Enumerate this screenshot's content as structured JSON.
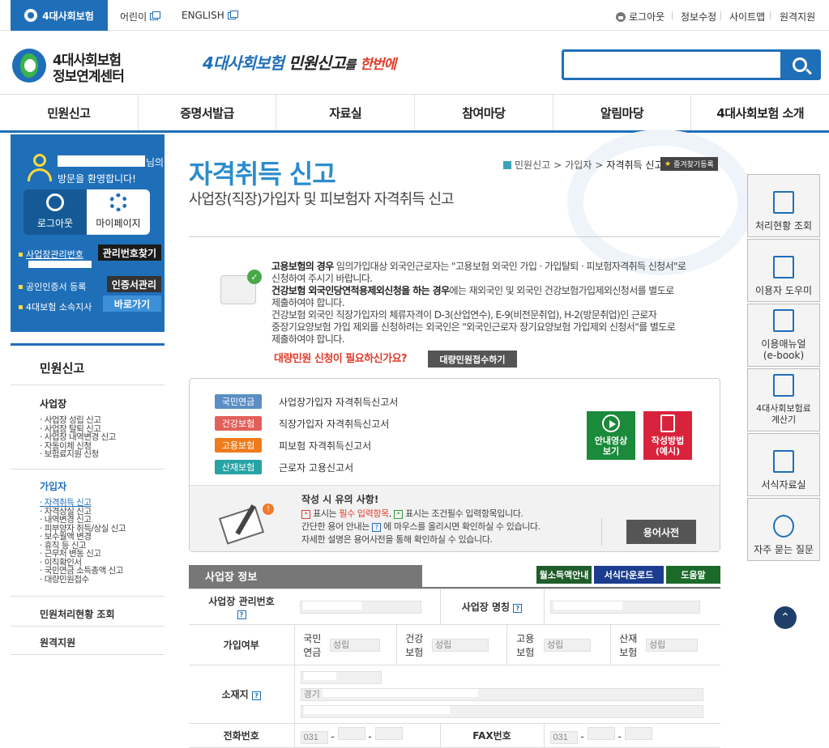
{
  "topbar": {
    "home": "4대사회보험",
    "links": [
      "어린이",
      "ENGLISH"
    ],
    "right": [
      "로그아웃",
      "정보수정",
      "사이트맵",
      "원격지원"
    ]
  },
  "header": {
    "logo_line1": "4대사회보험",
    "logo_line2": "정보연계센터",
    "slogan_blue": "4대사회보험",
    "slogan_black": "민원신고",
    "slogan_mid": "를",
    "slogan_red": "한번에",
    "search_placeholder": ""
  },
  "gnb": [
    "민원신고",
    "증명서발급",
    "자료실",
    "참여마당",
    "알림마당",
    "4대사회보험 소개"
  ],
  "userbox": {
    "name_suffix": "님의",
    "welcome": "방문을 환영합니다!",
    "logout": "로그아웃",
    "mypage": "마이페이지",
    "row1_label": "사업장관리번호",
    "row1_btn": "관리번호찾기",
    "row2_label": "공인인증서 등록",
    "row2_btn": "인증서관리",
    "row3_label": "4대보험 소속지사",
    "row3_btn": "바로가기"
  },
  "lnb": {
    "title": "민원신고",
    "sec1": "사업장",
    "sec1_items": [
      "사업장 성립 신고",
      "사업장 탈퇴 신고",
      "사업장 내역변경 신고",
      "자동이체 신청",
      "보험료지원 신청"
    ],
    "sec2": "가입자",
    "sec2_items": [
      "자격취득 신고",
      "자격상실 신고",
      "내역변경 신고",
      "피부양자 취득/상실 신고",
      "보수월액 변경",
      "휴직 등 신고",
      "근무처 변동 신고",
      "이직확인서",
      "국민연금 소득총액 신고",
      "대량민원접수"
    ],
    "item3": "민원처리현황 조회",
    "item4": "원격지원"
  },
  "content": {
    "title": "자격취득 신고",
    "subtitle": "사업장(직장)가입자 및 피보험자 자격취득 신고",
    "crumb1": "민원신고",
    "crumb2": "가입자",
    "crumb3": "자격취득 신고",
    "fav": "즐겨찾기등록",
    "notice": {
      "p1_bold": "고용보험의 경우",
      "p1_rest": " 임의가입대상 외국인근로자는 \"고용보험 외국인 가입 · 가입탈퇴 · 피보험자격취득 신청서\"로",
      "p1_line2": "신청하여 주시기 바랍니다.",
      "p2_bold": "건강보험 외국인당연적용제외신청을 하는 경우",
      "p2_rest": "에는 재외국인 및 외국인 건강보험가입제외신청서를 별도로",
      "p2_line2": "제출하여야 합니다.",
      "p3_l1": "건강보험 외국인 직장가입자의 체류자격이 D-3(산업연수), E-9(비전문취업), H-2(방문취업)인 근로자",
      "p3_l2": "중장기요양보험 가입 제외를 신청하려는 외국인은 \"외국인근로자 장기요양보험 가입제외 신청서\"를 별도로",
      "p3_l3": "제출하여야 합니다."
    },
    "bulk_q": "대량민원 신청이 필요하신가요?",
    "bulk_btn": "대량민원접수하기",
    "forms": [
      {
        "badge": "국민연금",
        "desc": "사업장가입자 자격취득신고서",
        "color": "#5b8ec4"
      },
      {
        "badge": "건강보험",
        "desc": "직장가입자 자격취득신고서",
        "color": "#e2605b"
      },
      {
        "badge": "고용보험",
        "desc": "피보험 자격취득신고서",
        "color": "#ef7b1c"
      },
      {
        "badge": "산재보험",
        "desc": "근로자 고용신고서",
        "color": "#27a3a3"
      }
    ],
    "video_btn_l1": "안내영상",
    "video_btn_l2": "보기",
    "howto_btn_l1": "작성방법",
    "howto_btn_l2": "(예시)",
    "warn_title": "작성 시 유의 사항!",
    "warn_tag_req": "*",
    "warn_l1_a": "표시는",
    "warn_l1_red": "필수 입력항목",
    "warn_l1_b": ",",
    "warn_tag_cond": "*",
    "warn_l1_c": "표시는 조건필수 입력항목입니다.",
    "warn_l2_a": "간단한 용어 안내는",
    "warn_tag_q": "?",
    "warn_l2_b": "에 마우스를 올리시면 확인하실 수 있습니다.",
    "warn_l3": "자세한 설명은 용어사전을 통해 확인하실 수 있습니다.",
    "dict_btn": "용어사전",
    "section_title": "사업장 정보",
    "btn_income": "월소득액안내",
    "btn_download": "서식다운로드",
    "btn_help": "도움말",
    "row1_l": "사업장 관리번호",
    "row1_r": "사업장 명칭",
    "row2_l": "가입여부",
    "row2_c1_l1": "국민",
    "row2_c1_l2": "연금",
    "row2_c2_l1": "건강",
    "row2_c2_l2": "보험",
    "row2_c3_l1": "고용",
    "row2_c3_l2": "보험",
    "row2_c4_l1": "산재",
    "row2_c4_l2": "보험",
    "status": "성립",
    "row3_l": "소재지",
    "addr_prefix": "경기",
    "row4_l": "전화번호",
    "row4_r": "FAX번호",
    "phone_prefix": "031",
    "fax_prefix": "031",
    "dash": "-"
  },
  "quick": [
    "처리현황 조회",
    "이용자 도우미",
    "이용매뉴얼\n(e-book)",
    "4대사회보험료\n계산기",
    "서식자료실",
    "자주 묻는 질문"
  ],
  "totop": "⌃"
}
